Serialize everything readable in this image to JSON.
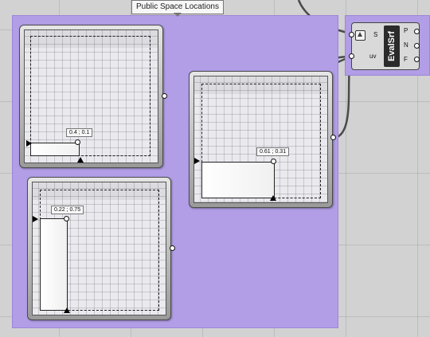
{
  "group": {
    "title": "Public Space Locations"
  },
  "sliders": [
    {
      "id": "slider-1",
      "value_label": "0.4 ; 0.1",
      "u": 0.4,
      "v": 0.1
    },
    {
      "id": "slider-2",
      "value_label": "0.61 ; 0.31",
      "u": 0.61,
      "v": 0.31
    },
    {
      "id": "slider-3",
      "value_label": "0.22 ; 0.75",
      "u": 0.22,
      "v": 0.75
    }
  ],
  "component": {
    "name": "EvalSrf",
    "inputs": [
      "S",
      "uv"
    ],
    "outputs": [
      "P",
      "N",
      "F"
    ]
  },
  "colors": {
    "group_fill": "#b19ee6",
    "canvas": "#d2d2d2",
    "wire": "#4a4a4a"
  }
}
